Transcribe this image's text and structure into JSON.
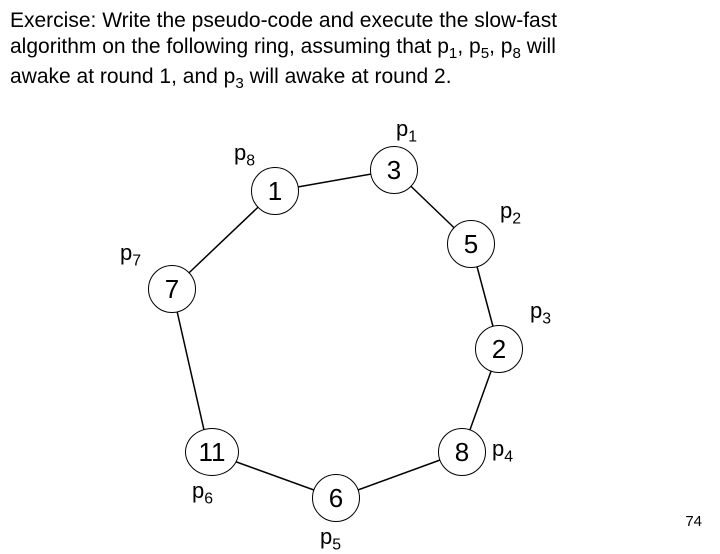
{
  "exercise": {
    "line1_pre": "Exercise: Write the pseudo-code and execute the slow-fast",
    "line2_pre": "algorithm on the following ring, assuming that p",
    "line2_s1": "1",
    "line2_mid1": ", p",
    "line2_s2": "5",
    "line2_mid2": ", p",
    "line2_s3": "8",
    "line2_post": " will",
    "line3_pre": "awake at round 1, and p",
    "line3_s1": "3",
    "line3_post": " will awake at round 2."
  },
  "nodes": {
    "n1": "3",
    "n2": "5",
    "n3": "2",
    "n4": "8",
    "n5": "6",
    "n6": "11",
    "n7": "7",
    "n8": "1"
  },
  "labels": {
    "p1": "p",
    "p1s": "1",
    "p2": "p",
    "p2s": "2",
    "p3": "p",
    "p3s": "3",
    "p4": "p",
    "p4s": "4",
    "p5": "p",
    "p5s": "5",
    "p6": "p",
    "p6s": "6",
    "p7": "p",
    "p7s": "7",
    "p8": "p",
    "p8s": "8"
  },
  "page": "74"
}
